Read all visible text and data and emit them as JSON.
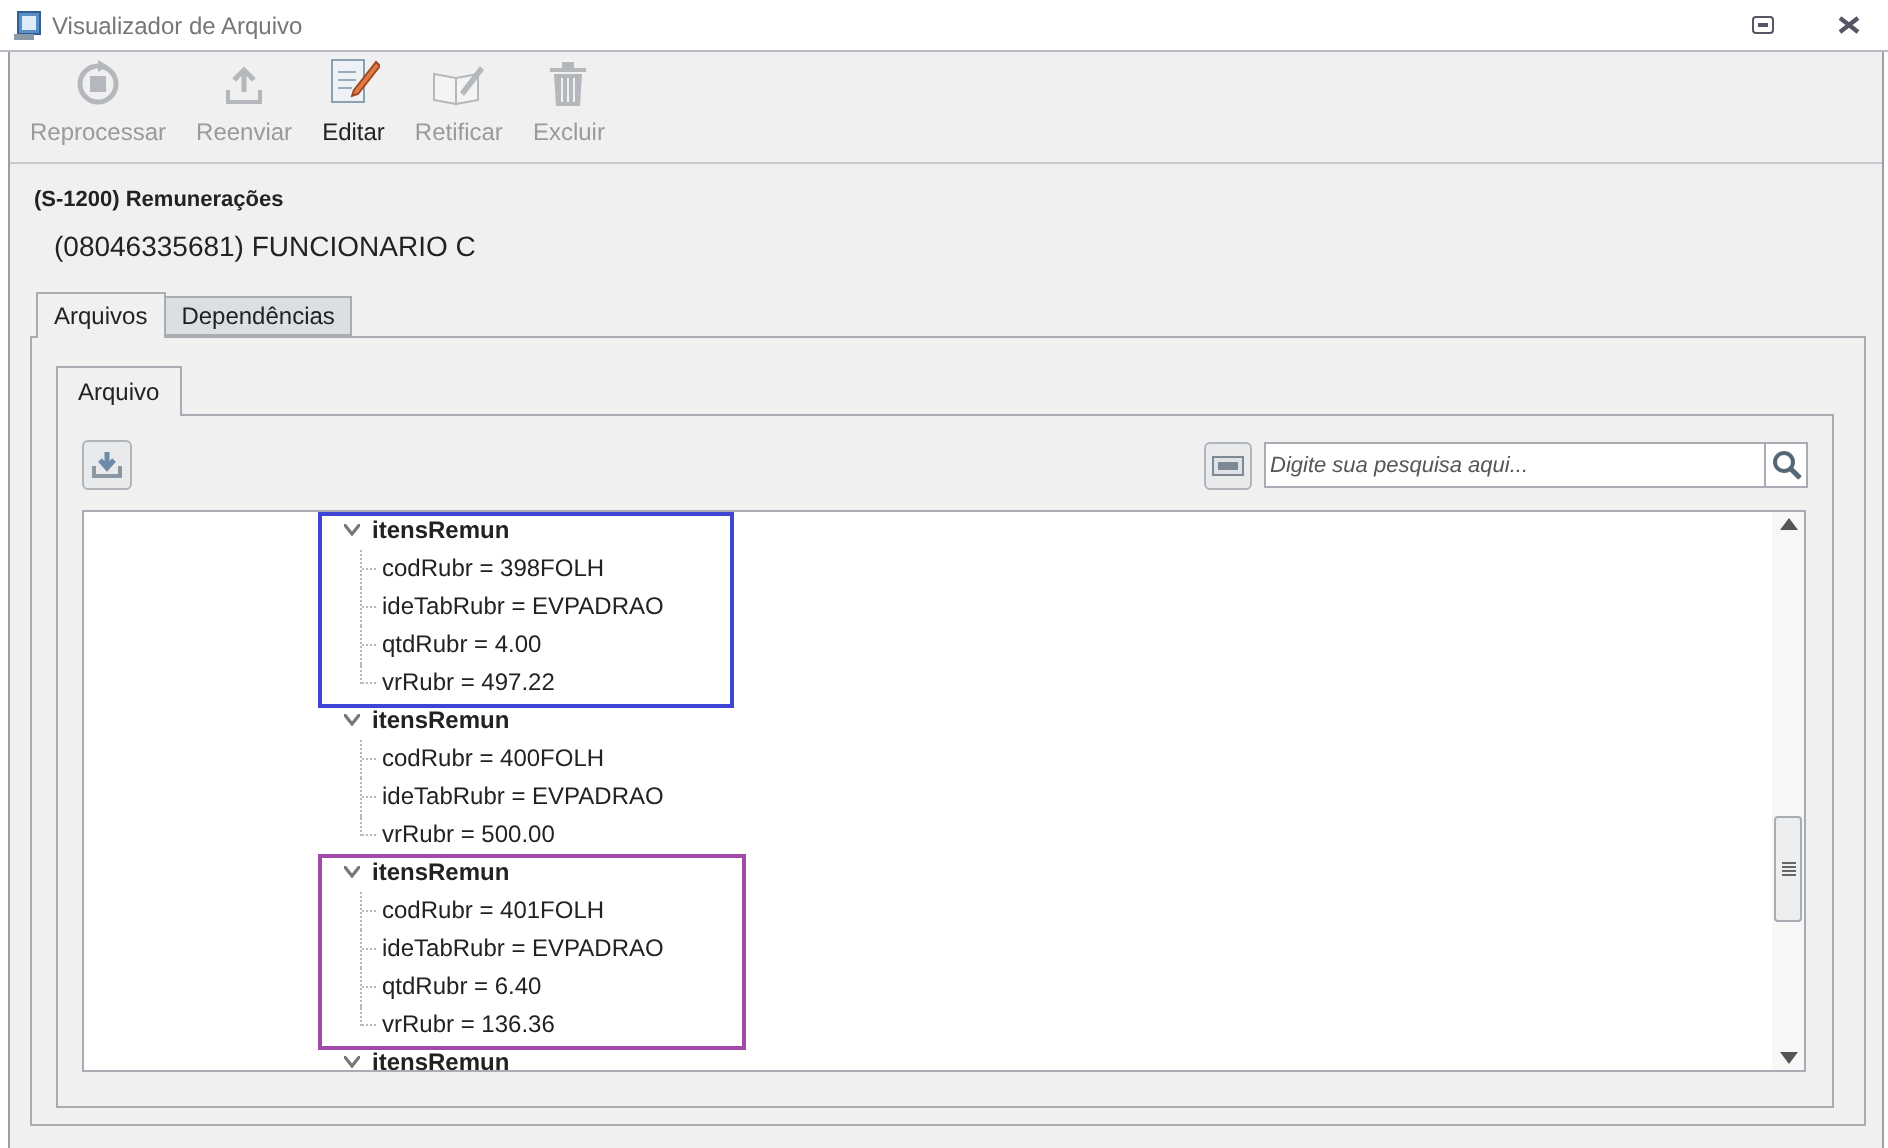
{
  "window": {
    "title": "Visualizador de Arquivo"
  },
  "toolbar": [
    {
      "label": "Reprocessar",
      "kind": "reprocess",
      "disabled": true
    },
    {
      "label": "Reenviar",
      "kind": "upload",
      "disabled": true
    },
    {
      "label": "Editar",
      "kind": "edit",
      "disabled": false
    },
    {
      "label": "Retificar",
      "kind": "rectify",
      "disabled": true
    },
    {
      "label": "Excluir",
      "kind": "delete",
      "disabled": true
    }
  ],
  "header": {
    "event": "(S-1200) Remunerações",
    "employee": "(08046335681) FUNCIONARIO C"
  },
  "tabs": [
    {
      "label": "Arquivos",
      "selected": true
    },
    {
      "label": "Dependências",
      "selected": false
    }
  ],
  "inner_tabs": [
    {
      "label": "Arquivo",
      "selected": true
    }
  ],
  "search": {
    "placeholder": "Digite sua pesquisa aqui..."
  },
  "tree": [
    {
      "label": "itensRemun",
      "expanded": true,
      "color": "#3c46d2",
      "children": [
        {
          "label": "codRubr = 398FOLH"
        },
        {
          "label": "ideTabRubr = EVPADRAO"
        },
        {
          "label": "qtdRubr = 4.00"
        },
        {
          "label": "vrRubr = 497.22"
        }
      ]
    },
    {
      "label": "itensRemun",
      "expanded": true,
      "children": [
        {
          "label": "codRubr = 400FOLH"
        },
        {
          "label": "ideTabRubr = EVPADRAO"
        },
        {
          "label": "vrRubr = 500.00"
        }
      ]
    },
    {
      "label": "itensRemun",
      "expanded": true,
      "color": "#a24aa8",
      "children": [
        {
          "label": "codRubr = 401FOLH"
        },
        {
          "label": "ideTabRubr = EVPADRAO"
        },
        {
          "label": "qtdRubr = 6.40"
        },
        {
          "label": "vrRubr = 136.36"
        }
      ]
    },
    {
      "label": "itensRemun",
      "expanded": true
    }
  ]
}
